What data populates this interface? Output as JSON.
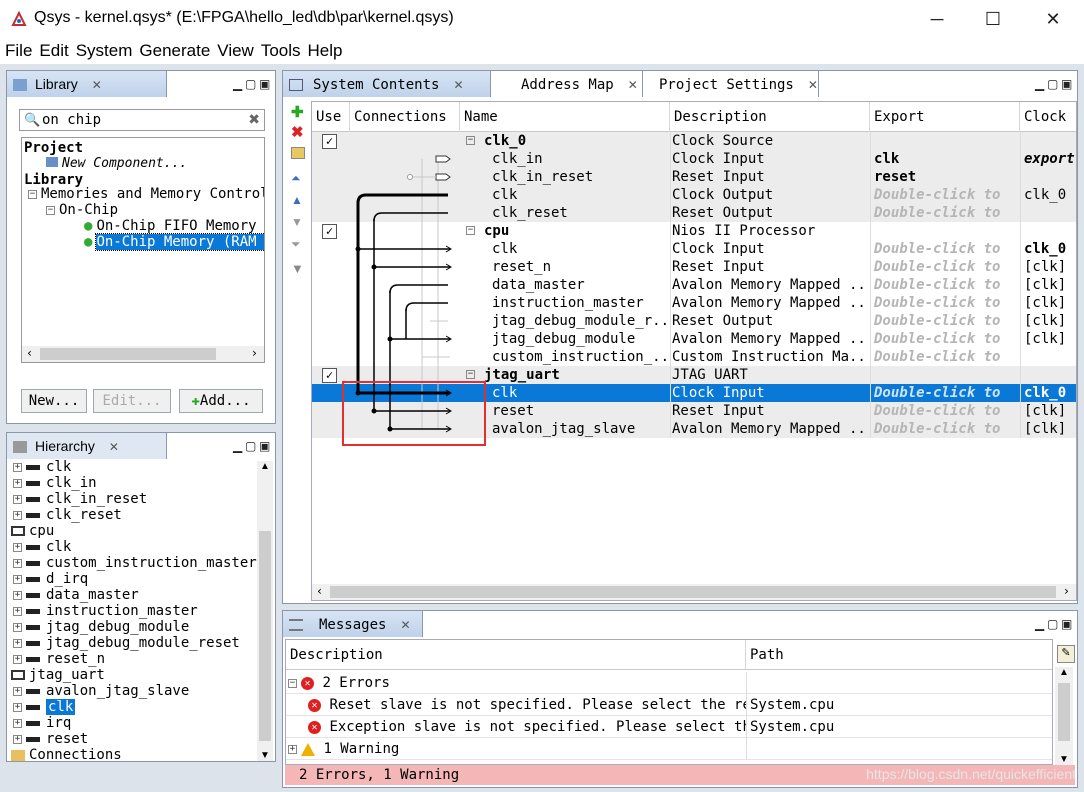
{
  "window": {
    "title": "Qsys - kernel.qsys* (E:\\FPGA\\hello_led\\db\\par\\kernel.qsys)",
    "minimize": "─",
    "maximize": "☐",
    "close": "✕"
  },
  "menu": [
    "File",
    "Edit",
    "System",
    "Generate",
    "View",
    "Tools",
    "Help"
  ],
  "library": {
    "tab": "Library",
    "search_value": "on chip",
    "project_heading": "Project",
    "new_component": "New Component...",
    "library_heading": "Library",
    "node_memories": "Memories and Memory Controll",
    "node_onchip": "On-Chip",
    "item_fifo": "On-Chip FIFO Memory",
    "item_ram": "On-Chip Memory (RAM o",
    "buttons": {
      "new": "New...",
      "edit": "Edit...",
      "add": "Add..."
    }
  },
  "hierarchy": {
    "tab": "Hierarchy",
    "items": [
      {
        "label": "clk",
        "indent": 1,
        "icon": "port"
      },
      {
        "label": "clk_in",
        "indent": 1,
        "icon": "port"
      },
      {
        "label": "clk_in_reset",
        "indent": 1,
        "icon": "port"
      },
      {
        "label": "clk_reset",
        "indent": 1,
        "icon": "port"
      },
      {
        "label": "cpu",
        "indent": 0,
        "icon": "component"
      },
      {
        "label": "clk",
        "indent": 1,
        "icon": "port"
      },
      {
        "label": "custom_instruction_master",
        "indent": 1,
        "icon": "port"
      },
      {
        "label": "d_irq",
        "indent": 1,
        "icon": "port"
      },
      {
        "label": "data_master",
        "indent": 1,
        "icon": "port"
      },
      {
        "label": "instruction_master",
        "indent": 1,
        "icon": "port"
      },
      {
        "label": "jtag_debug_module",
        "indent": 1,
        "icon": "port"
      },
      {
        "label": "jtag_debug_module_reset",
        "indent": 1,
        "icon": "port"
      },
      {
        "label": "reset_n",
        "indent": 1,
        "icon": "port"
      },
      {
        "label": "jtag_uart",
        "indent": 0,
        "icon": "component"
      },
      {
        "label": "avalon_jtag_slave",
        "indent": 1,
        "icon": "port"
      },
      {
        "label": "clk",
        "indent": 1,
        "icon": "port",
        "selected": true
      },
      {
        "label": "irq",
        "indent": 1,
        "icon": "port"
      },
      {
        "label": "reset",
        "indent": 1,
        "icon": "port"
      },
      {
        "label": "Connections",
        "indent": 0,
        "icon": "folder"
      }
    ]
  },
  "system": {
    "tabs": [
      "System Contents",
      "Address Map",
      "Project Settings"
    ],
    "columns": [
      "Use",
      "Connections",
      "Name",
      "Description",
      "Export",
      "Clock"
    ],
    "rows": [
      {
        "use": true,
        "name": "clk_0",
        "group": true,
        "desc": "Clock Source",
        "export": "",
        "exportStyle": "",
        "clock": "",
        "gray": true
      },
      {
        "name": "clk_in",
        "desc": "Clock Input",
        "export": "clk",
        "exportStyle": "bold",
        "clock": "export",
        "clockStyle": "bi",
        "gray": true
      },
      {
        "name": "clk_in_reset",
        "desc": "Reset Input",
        "export": "reset",
        "exportStyle": "bold",
        "clock": "",
        "gray": true
      },
      {
        "name": "clk",
        "desc": "Clock Output",
        "export": "Double-click to",
        "exportStyle": "dc",
        "clock": "clk_0",
        "gray": true
      },
      {
        "name": "clk_reset",
        "desc": "Reset Output",
        "export": "Double-click to",
        "exportStyle": "dc",
        "clock": "",
        "gray": true
      },
      {
        "use": true,
        "name": "cpu",
        "group": true,
        "desc": "Nios II Processor",
        "export": "",
        "exportStyle": "",
        "clock": "",
        "gray": false
      },
      {
        "name": "clk",
        "desc": "Clock Input",
        "export": "Double-click to",
        "exportStyle": "dc",
        "clock": "clk_0",
        "clockStyle": "bold",
        "gray": false
      },
      {
        "name": "reset_n",
        "desc": "Reset Input",
        "export": "Double-click to",
        "exportStyle": "dc",
        "clock": "[clk]",
        "gray": false
      },
      {
        "name": "data_master",
        "desc": "Avalon Memory Mapped ...",
        "export": "Double-click to",
        "exportStyle": "dc",
        "clock": "[clk]",
        "gray": false
      },
      {
        "name": "instruction_master",
        "desc": "Avalon Memory Mapped ...",
        "export": "Double-click to",
        "exportStyle": "dc",
        "clock": "[clk]",
        "gray": false
      },
      {
        "name": "jtag_debug_module_r...",
        "desc": "Reset Output",
        "export": "Double-click to",
        "exportStyle": "dc",
        "clock": "[clk]",
        "gray": false
      },
      {
        "name": "jtag_debug_module",
        "desc": "Avalon Memory Mapped ...",
        "export": "Double-click to",
        "exportStyle": "dc",
        "clock": "[clk]",
        "gray": false
      },
      {
        "name": "custom_instruction_...",
        "desc": "Custom Instruction Ma...",
        "export": "Double-click to",
        "exportStyle": "dc",
        "clock": "",
        "gray": false
      },
      {
        "use": true,
        "name": "jtag_uart",
        "group": true,
        "desc": "JTAG UART",
        "export": "",
        "exportStyle": "",
        "clock": "",
        "gray": true
      },
      {
        "name": "clk",
        "desc": "Clock Input",
        "export": "Double-click to",
        "exportStyle": "dc",
        "clock": "clk_0",
        "clockStyle": "bold",
        "gray": true,
        "selected": true
      },
      {
        "name": "reset",
        "desc": "Reset Input",
        "export": "Double-click to",
        "exportStyle": "dc",
        "clock": "[clk]",
        "gray": true
      },
      {
        "name": "avalon_jtag_slave",
        "desc": "Avalon Memory Mapped ...",
        "export": "Double-click to",
        "exportStyle": "dc",
        "clock": "[clk]",
        "gray": true
      }
    ]
  },
  "messages": {
    "tab": "Messages",
    "columns": [
      "Description",
      "Path"
    ],
    "rows": [
      {
        "kind": "group-error",
        "text": "2 Errors",
        "path": ""
      },
      {
        "kind": "error",
        "text": "Reset slave is not specified. Please select the rese",
        "path": "System.cpu"
      },
      {
        "kind": "error",
        "text": "Exception slave is not specified. Please select the",
        "path": "System.cpu"
      },
      {
        "kind": "group-warning",
        "text": "1 Warning",
        "path": ""
      }
    ],
    "status": "2 Errors, 1 Warning",
    "watermark": "https://blog.csdn.net/quickefficient",
    "colors": {
      "status_bg": "#f4b6b6"
    }
  },
  "colors": {
    "selection": "#0a78d7",
    "highlight_box": "#e03030"
  }
}
